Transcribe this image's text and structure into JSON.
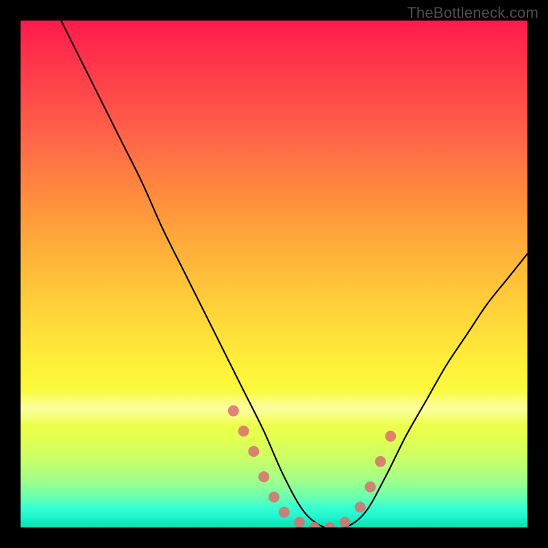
{
  "watermark": "TheBottleneck.com",
  "chart_data": {
    "type": "line",
    "title": "",
    "xlabel": "",
    "ylabel": "",
    "xlim": [
      0,
      100
    ],
    "ylim": [
      0,
      100
    ],
    "grid": false,
    "legend": false,
    "series": [
      {
        "name": "bottleneck-curve",
        "color": "#000000",
        "x": [
          8,
          12,
          16,
          20,
          24,
          28,
          32,
          36,
          40,
          44,
          48,
          52,
          56,
          60,
          64,
          68,
          72,
          76,
          80,
          84,
          88,
          92,
          96,
          100
        ],
        "y": [
          100,
          92,
          84,
          76,
          68,
          59,
          51,
          43,
          35,
          27,
          19,
          10,
          3,
          0,
          0,
          3,
          10,
          18,
          25,
          32,
          38,
          44,
          49,
          54
        ]
      }
    ],
    "markers": {
      "name": "highlight-dots",
      "color": "#d96f6f",
      "radius_px": 8,
      "x": [
        42,
        44,
        46,
        48,
        50,
        52,
        55,
        58,
        61,
        64,
        67,
        69,
        71,
        73
      ],
      "y": [
        23,
        19,
        15,
        10,
        6,
        3,
        1,
        0,
        0,
        1,
        4,
        8,
        13,
        18
      ]
    },
    "background_gradient": {
      "type": "vertical",
      "stops": [
        {
          "pos": 0.0,
          "color": "#ff1a4d"
        },
        {
          "pos": 0.35,
          "color": "#ff8a3e"
        },
        {
          "pos": 0.65,
          "color": "#fff03a"
        },
        {
          "pos": 0.88,
          "color": "#c6ff6b"
        },
        {
          "pos": 1.0,
          "color": "#11e5b0"
        }
      ]
    }
  }
}
